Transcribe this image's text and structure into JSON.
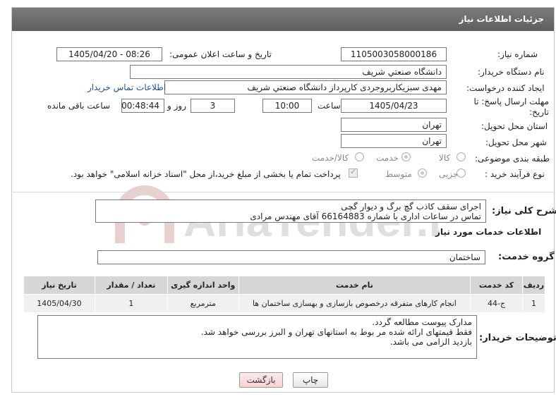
{
  "header": {
    "title": "جزئیات اطلاعات نیاز"
  },
  "fields": {
    "need_number_label": "شماره نیاز:",
    "need_number": "1105003058000186",
    "announce_label": "تاریخ و ساعت اعلان عمومی:",
    "announce_value": "1405/04/20 - 08:26",
    "buyer_org_label": "نام دستگاه خریدار:",
    "buyer_org": "دانشگاه صنعتي شريف",
    "creator_label": "ایجاد کننده درخواست:",
    "creator": "مهدی سبزیکاربروجردی کارپرداز دانشگاه صنعتي شريف",
    "buyer_contact_link": "اطلاعات تماس خریدار",
    "deadline_label": "مهلت ارسال پاسخ: تا تاریخ:",
    "deadline_date": "1405/04/23",
    "time_label": "ساعت",
    "deadline_time": "10:00",
    "days_value": "3",
    "days_label": "روز و",
    "remaining_time": "00:48:44",
    "remaining_label": "ساعت باقی مانده",
    "province_label": "استان محل تحویل:",
    "province": "تهران",
    "city_label": "شهر محل تحویل:",
    "city": "تهران",
    "category_label": "طبقه بندی موضوعی:",
    "category_options": [
      "کالا",
      "خدمت",
      "کالا/خدمت"
    ],
    "process_label": "نوع فرآیند خرید :",
    "process_options": [
      "جزیی",
      "متوسط"
    ],
    "payment_note": "پرداخت تمام یا بخشی از مبلغ خرید،از محل \"اسناد خزانه اسلامی\" خواهد بود."
  },
  "summary": {
    "label": "شرح کلی نیاز:",
    "text": "اجرای سقف کاذب گچ برگ و دیوار گچی\nتماس در ساعات اداری با شماره 66164883 آقای مهندس مرادی"
  },
  "services": {
    "section_title": "اطلاعات خدمات مورد نیاز",
    "group_label": "گروه خدمت:",
    "group_value": "ساختمان",
    "table": {
      "headers": [
        "ردیف",
        "کد خدمت",
        "نام خدمت",
        "واحد اندازه گیری",
        "تعداد / مقدار",
        "تاریخ نیاز"
      ],
      "rows": [
        [
          "1",
          "ج-44",
          "انجام کارهای متفرقه درخصوص بازسازی و بهسازی ساختمان ها",
          "مترمربع",
          "1",
          "1405/04/30"
        ]
      ]
    }
  },
  "buyer_notes": {
    "label": "توضیحات خریدار:",
    "text": "مدارک پیوست مطالعه گردد.\nفقط قیمتهای ارائه شده مر بوط به استانهای تهران و البرز بررسی خواهد شد.\nبازدید الزامی می باشد."
  },
  "buttons": {
    "print": "چاپ",
    "back": "بازگشت"
  },
  "watermark": {
    "text": "AriaTender.neT"
  },
  "colors": {
    "header_bg": "#6b6b6b",
    "link": "#1a4fa0",
    "back_btn": "#f6d3d3"
  }
}
